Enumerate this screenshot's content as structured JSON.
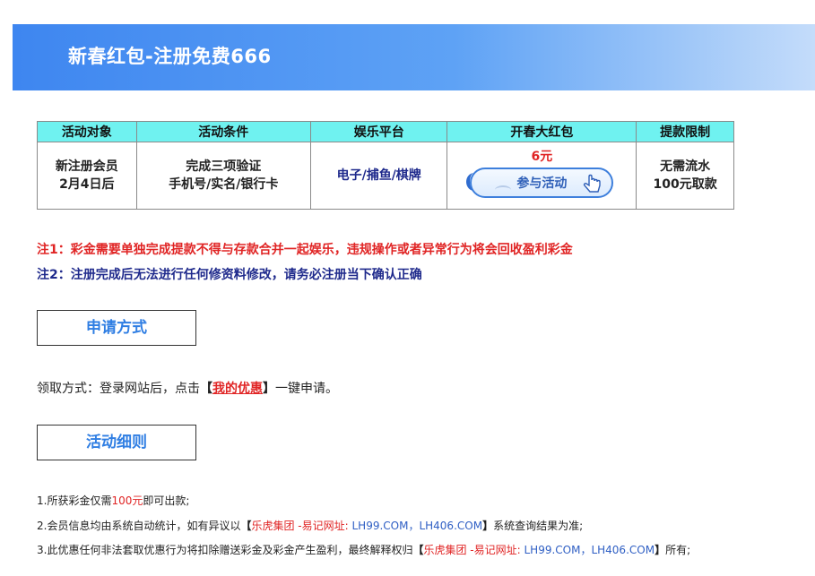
{
  "banner": {
    "title": "新春红包-注册免费666"
  },
  "table": {
    "headers": [
      "活动对象",
      "活动条件",
      "娱乐平台",
      "开春大红包",
      "提款限制"
    ],
    "target": [
      "新注册会员",
      "2月4日后"
    ],
    "condition": [
      "完成三项验证",
      "手机号/实名/银行卡"
    ],
    "platform": "电子/捕鱼/棋牌",
    "bonus_amount": "6元",
    "join_button": "参与活动",
    "limit": [
      "无需流水",
      "100元取款"
    ]
  },
  "notes": {
    "note1": "注1：彩金需要单独完成提款不得与存款合并一起娱乐，违规操作或者异常行为将会回收盈利彩金",
    "note2": "注2：注册完成后无法进行任何修资料修改，请务必注册当下确认正确"
  },
  "apply_section": {
    "title": "申请方式",
    "text_prefix": "领取方式：登录网站后，点击",
    "bracket_open": "【",
    "link": "我的优惠",
    "bracket_close": "】",
    "text_suffix": "一键申请。"
  },
  "rules_section": {
    "title": "活动细则",
    "rule1": {
      "prefix": "1.所获彩金仅需",
      "amount": "100元",
      "suffix": "即可出款;"
    },
    "rule2": {
      "prefix": "2.会员信息均由系统自动统计，如有异议以",
      "br_open": "【",
      "group": "乐虎集团 -易记网址:",
      "urls": " LH99.COM，LH406.COM",
      "br_close": "】",
      "suffix": "系统查询结果为准;"
    },
    "rule3": {
      "prefix": "3.此优惠任何非法套取优惠行为将扣除赠送彩金及彩金产生盈利，最终解释权归",
      "br_open": "【",
      "group": "乐虎集团 -易记网址:",
      "urls": " LH99.COM，LH406.COM",
      "br_close": "】",
      "suffix": "所有;"
    }
  },
  "colors": {
    "banner": "#3e86f0",
    "header_cell": "#6ff2f0",
    "red": "#e02424",
    "navy": "#1f2a8c",
    "section_blue": "#2f7ee3"
  }
}
